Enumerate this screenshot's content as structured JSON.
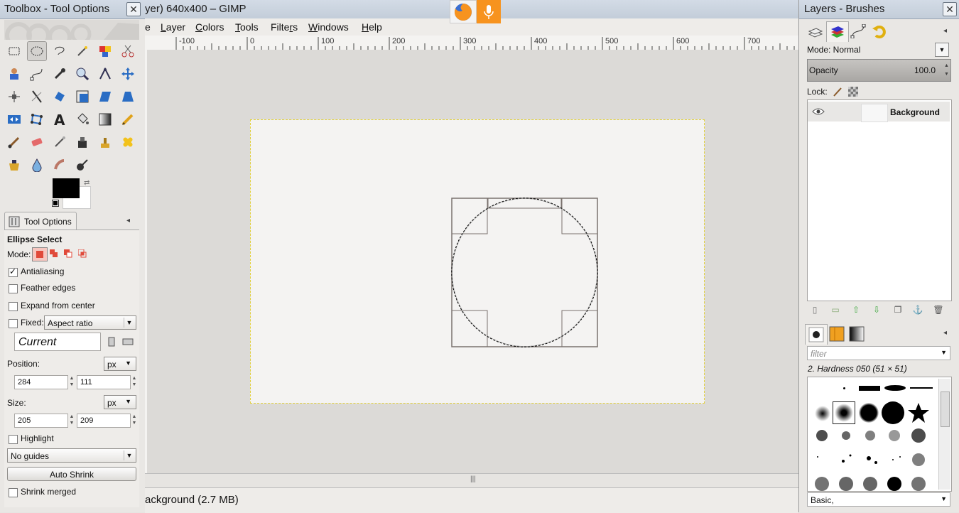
{
  "toolbox": {
    "title": "Toolbox - Tool Options",
    "tab_label": "Tool Options",
    "tool_name": "Ellipse Select",
    "mode_label": "Mode:",
    "antialiasing_label": "Antialiasing",
    "antialiasing_checked": true,
    "feather_label": "Feather edges",
    "expand_label": "Expand from center",
    "fixed_label": "Fixed:",
    "fixed_value": "Aspect ratio",
    "current_value": "Current",
    "position_label": "Position:",
    "position_unit": "px",
    "position_x": "284",
    "position_y": "111",
    "size_label": "Size:",
    "size_unit": "px",
    "size_w": "205",
    "size_h": "209",
    "highlight_label": "Highlight",
    "guides_value": "No guides",
    "auto_shrink_label": "Auto Shrink",
    "shrink_merged_label": "Shrink merged",
    "foreground_color": "#000000",
    "background_color": "#ffffff"
  },
  "image_window": {
    "title": "yer) 640x400 – GIMP",
    "menus": [
      {
        "label": "e",
        "key": ""
      },
      {
        "label": "Layer",
        "key": "L"
      },
      {
        "label": "Colors",
        "key": "C"
      },
      {
        "label": "Tools",
        "key": "T"
      },
      {
        "label": "Filters",
        "key": "r"
      },
      {
        "label": "Windows",
        "key": "W"
      },
      {
        "label": "Help",
        "key": "H"
      }
    ],
    "ruler_ticks": [
      "-100",
      "0",
      "100",
      "200",
      "300",
      "400",
      "500",
      "600",
      "700"
    ],
    "status": "ackground (2.7 MB)"
  },
  "taskbar": {
    "firefox_icon": "firefox-icon",
    "mic_icon": "microphone-icon",
    "accent": "#f7931e"
  },
  "dock": {
    "title": "Layers - Brushes",
    "mode_label": "Mode: Normal",
    "opacity_label": "Opacity",
    "opacity_value": "100.0",
    "lock_label": "Lock:",
    "layer_name": "Background",
    "filter_placeholder": "filter",
    "brush_name": "2. Hardness 050 (51 × 51)",
    "brush_tag": "Basic,"
  }
}
